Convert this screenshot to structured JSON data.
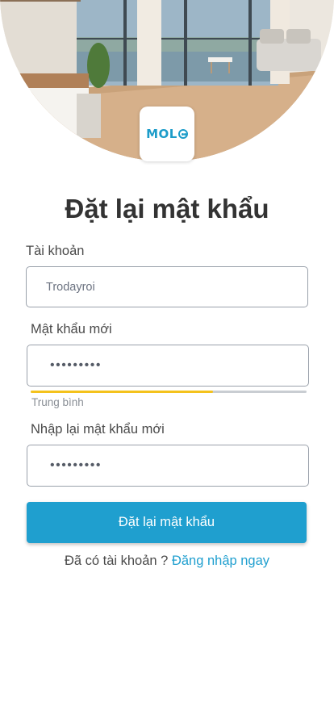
{
  "brand": {
    "logo_text": "MOL",
    "accent_color": "#1f9fcf"
  },
  "page": {
    "title": "Đặt lại mật khẩu"
  },
  "form": {
    "account": {
      "label": "Tài khoản",
      "value": "Trodayroi"
    },
    "new_password": {
      "label": "Mật khẩu mới",
      "value": "•••••••••"
    },
    "strength": {
      "label": "Trung bình",
      "level": 0.66,
      "color": "#f4c21c"
    },
    "confirm_password": {
      "label": "Nhập lại mật khẩu mới",
      "value": "•••••••••"
    },
    "submit_label": "Đặt lại mật khẩu"
  },
  "footer": {
    "prompt": "Đã có tài khoản ? ",
    "link_label": "Đăng nhập ngay"
  }
}
